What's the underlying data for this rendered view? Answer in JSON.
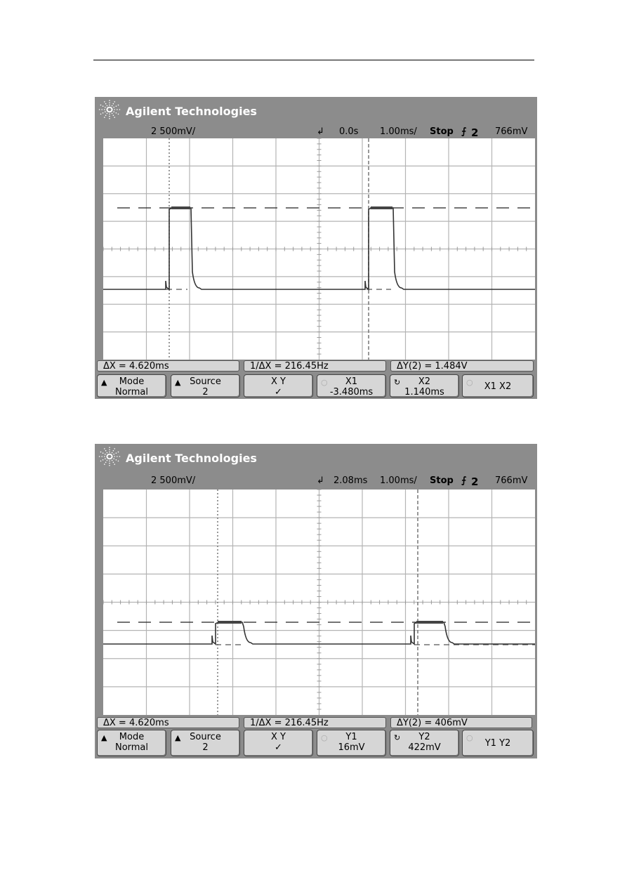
{
  "scopes": [
    {
      "brand": "Agilent Technologies",
      "channel_scale": "2 500mV/",
      "trigger_delay": "0.0s",
      "timebase": "1.00ms/",
      "run_state": "Stop",
      "trigger_source": "2",
      "trigger_level": "766mV",
      "measurements": {
        "dx": "ΔX = 4.620ms",
        "inv_dx": "1/ΔX = 216.45Hz",
        "dy": "ΔY(2) = 1.484V"
      },
      "softkeys": [
        {
          "l1": "Mode",
          "l2": "Normal",
          "icon": "▲"
        },
        {
          "l1": "Source",
          "l2": "2",
          "icon": "▲"
        },
        {
          "l1": "X        Y",
          "l2": "✓",
          "icon": ""
        },
        {
          "l1": "X1",
          "l2": "-3.480ms",
          "icon": "○"
        },
        {
          "l1": "X2",
          "l2": "1.140ms",
          "icon": "↻"
        },
        {
          "l1": "X1  X2",
          "l2": "",
          "icon": "○"
        }
      ]
    },
    {
      "brand": "Agilent Technologies",
      "channel_scale": "2 500mV/",
      "trigger_delay": "2.08ms",
      "timebase": "1.00ms/",
      "run_state": "Stop",
      "trigger_source": "2",
      "trigger_level": "766mV",
      "measurements": {
        "dx": "ΔX = 4.620ms",
        "inv_dx": "1/ΔX = 216.45Hz",
        "dy": "ΔY(2) = 406mV"
      },
      "softkeys": [
        {
          "l1": "Mode",
          "l2": "Normal",
          "icon": "▲"
        },
        {
          "l1": "Source",
          "l2": "2",
          "icon": "▲"
        },
        {
          "l1": "X        Y",
          "l2": "✓",
          "icon": ""
        },
        {
          "l1": "Y1",
          "l2": "16mV",
          "icon": "○"
        },
        {
          "l1": "Y2",
          "l2": "422mV",
          "icon": "↻"
        },
        {
          "l1": "Y1  Y2",
          "l2": "",
          "icon": "○"
        }
      ]
    }
  ]
}
